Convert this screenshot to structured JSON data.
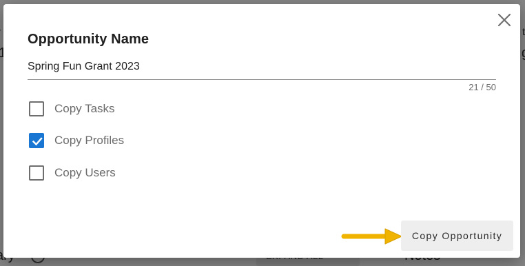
{
  "dialog": {
    "title": "Opportunity Name",
    "name_value": "Spring Fun Grant 2023",
    "char_counter": "21 / 50",
    "options": [
      {
        "label": "Copy Tasks",
        "checked": false
      },
      {
        "label": "Copy Profiles",
        "checked": true
      },
      {
        "label": "Copy Users",
        "checked": false
      }
    ],
    "copy_button_label": "Copy Opportunity",
    "close_icon": "close-icon"
  },
  "background": {
    "left_fragment_small": "r",
    "left_fragment_big": "1",
    "right_fragment_small": "tt",
    "right_fragment_big": "g",
    "bottom_left_fragment": "ary",
    "bottom_chip_text": "EXPAND ALL",
    "bottom_notes_text": "Notes"
  },
  "colors": {
    "accent": "#1976d2",
    "arrow": "#f0b400",
    "scrim": "rgba(0,0,0,0.45)"
  }
}
